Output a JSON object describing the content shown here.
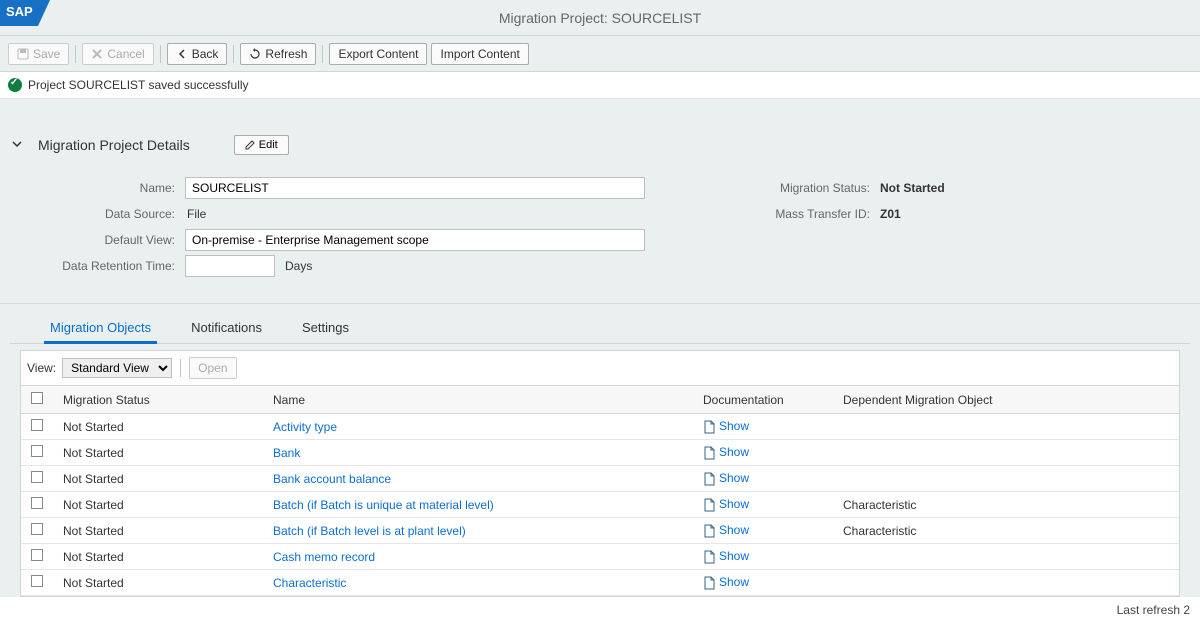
{
  "page_title_prefix": "Migration Project: ",
  "page_title_value": "SOURCELIST",
  "toolbar": {
    "save": "Save",
    "cancel": "Cancel",
    "back": "Back",
    "refresh": "Refresh",
    "export": "Export Content",
    "import": "Import Content"
  },
  "status_message": "Project SOURCELIST saved successfully",
  "section": {
    "title": "Migration Project Details",
    "edit": "Edit"
  },
  "details": {
    "labels": {
      "name": "Name:",
      "data_source": "Data Source:",
      "default_view": "Default View:",
      "retention": "Data Retention Time:",
      "days": "Days",
      "migration_status": "Migration Status:",
      "mass_transfer_id": "Mass Transfer ID:"
    },
    "values": {
      "name": "SOURCELIST",
      "data_source": "File",
      "default_view": "On-premise - Enterprise Management scope",
      "retention": "",
      "migration_status": "Not Started",
      "mass_transfer_id": "Z01"
    }
  },
  "tabs": {
    "migration_objects": "Migration Objects",
    "notifications": "Notifications",
    "settings": "Settings"
  },
  "table": {
    "view_label": "View:",
    "view_value": "Standard View",
    "open": "Open",
    "columns": {
      "migration_status": "Migration Status",
      "name": "Name",
      "documentation": "Documentation",
      "dependent": "Dependent Migration Object"
    },
    "show": "Show",
    "rows": [
      {
        "status": "Not Started",
        "name": "Activity type",
        "dep": ""
      },
      {
        "status": "Not Started",
        "name": "Bank",
        "dep": ""
      },
      {
        "status": "Not Started",
        "name": "Bank account balance",
        "dep": ""
      },
      {
        "status": "Not Started",
        "name": "Batch (if Batch is unique at material level)",
        "dep": "Characteristic"
      },
      {
        "status": "Not Started",
        "name": "Batch (if Batch level is at plant level)",
        "dep": "Characteristic"
      },
      {
        "status": "Not Started",
        "name": "Cash memo record",
        "dep": ""
      },
      {
        "status": "Not Started",
        "name": "Characteristic",
        "dep": ""
      }
    ]
  },
  "footer": "Last refresh 2"
}
